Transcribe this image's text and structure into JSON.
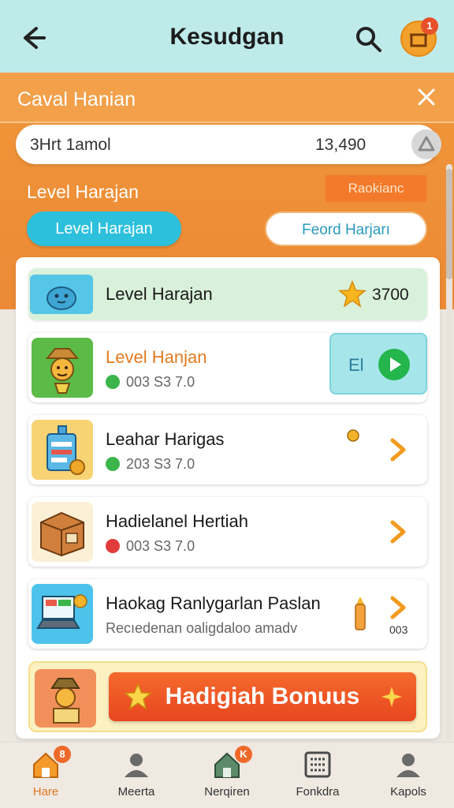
{
  "header": {
    "title": "Kesudgan",
    "back_icon": "arrow-left-icon",
    "search_icon": "search-icon",
    "avatar_badge": "1"
  },
  "panel": {
    "title": "Caval Hanian",
    "close_icon": "close-x-icon"
  },
  "search": {
    "value": "3Hrt 1amol",
    "amount": "13,490"
  },
  "section": {
    "label": "Level Harajan",
    "tag": "Raokianc"
  },
  "tabs": [
    {
      "label": "Level Harajan",
      "active": true
    },
    {
      "label": "Feord Harjarı",
      "active": false
    }
  ],
  "featured": {
    "title": "Level Harajan",
    "score": "3700"
  },
  "rows": [
    {
      "title": "Level Hanjan",
      "sub": "003 S3 7.0",
      "dot": "#3cb54a",
      "action": "El"
    },
    {
      "title": "Leahar Harigas",
      "sub": "203 S3 7.0",
      "dot": "#3cb54a"
    },
    {
      "title": "Hadielanel Hertiah",
      "sub": "003 S3 7.0",
      "dot": "#e23b3b"
    },
    {
      "title": "Haokag Ranlygarlan Paslan",
      "sub": "Recıedenan oaligdaloo amadv",
      "extra": "003"
    }
  ],
  "bonus": {
    "label": "Hadigiah Bonuus"
  },
  "nav": [
    {
      "label": "Hare",
      "icon": "home-icon",
      "badge": "8",
      "active": true
    },
    {
      "label": "Meerta",
      "icon": "user-icon"
    },
    {
      "label": "Nerqiren",
      "icon": "house-icon",
      "badge": "K"
    },
    {
      "label": "Fonkdra",
      "icon": "grid-icon"
    },
    {
      "label": "Kapols",
      "icon": "profile-icon"
    }
  ],
  "colors": {
    "accent": "#f0963a",
    "teal": "#2cc0dc",
    "bonus": "#e9461f"
  }
}
